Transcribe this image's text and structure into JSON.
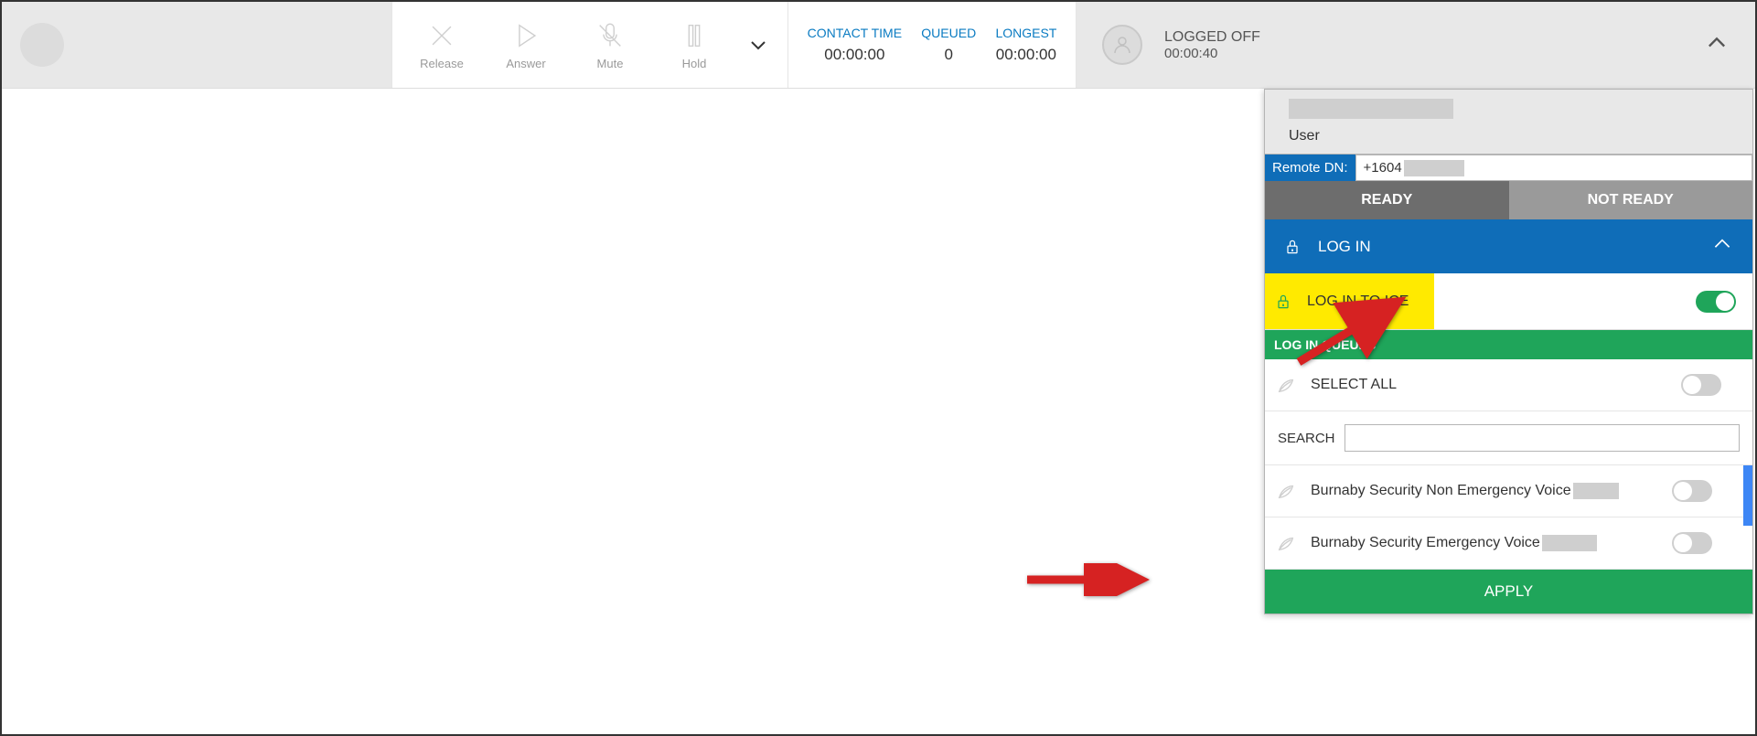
{
  "toolbar": {
    "release": "Release",
    "answer": "Answer",
    "mute": "Mute",
    "hold": "Hold"
  },
  "stats": {
    "contact_time_label": "CONTACT TIME",
    "contact_time_value": "00:00:00",
    "queued_label": "QUEUED",
    "queued_value": "0",
    "longest_label": "LONGEST",
    "longest_value": "00:00:00"
  },
  "status": {
    "title": "LOGGED OFF",
    "time": "00:00:40"
  },
  "panel": {
    "user_label": "User",
    "remote_dn_label": "Remote DN:",
    "remote_dn_value": "+1604",
    "ready": "READY",
    "not_ready": "NOT READY",
    "login_header": "LOG IN",
    "login_ice": "LOG IN TO ICE",
    "queues_header": "LOG IN QUEUES",
    "select_all": "SELECT ALL",
    "search_label": "SEARCH",
    "queues": [
      {
        "name": "Burnaby Security Non Emergency Voice"
      },
      {
        "name": "Burnaby Security Emergency Voice"
      }
    ],
    "apply": "APPLY"
  }
}
